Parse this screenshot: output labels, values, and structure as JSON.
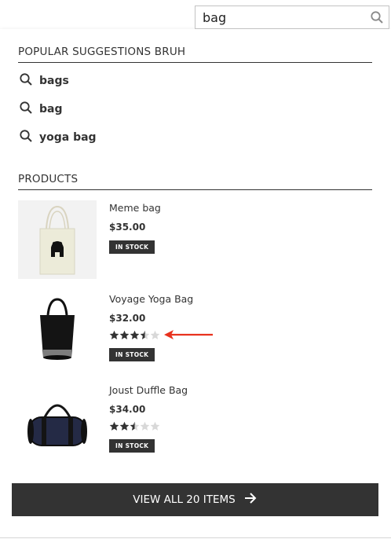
{
  "search": {
    "value": "bag"
  },
  "suggestions": {
    "title": "POPULAR SUGGESTIONS BRUH",
    "items": [
      {
        "label": "bags"
      },
      {
        "label": "bag"
      },
      {
        "label": "yoga bag"
      }
    ]
  },
  "products": {
    "title": "PRODUCTS",
    "items": [
      {
        "name": "Meme bag",
        "price": "$35.00",
        "rating": null,
        "stock": "IN STOCK"
      },
      {
        "name": "Voyage Yoga Bag",
        "price": "$32.00",
        "rating": 3.5,
        "stock": "IN STOCK"
      },
      {
        "name": "Joust Duffle Bag",
        "price": "$34.00",
        "rating": 2.5,
        "stock": "IN STOCK"
      }
    ]
  },
  "view_all": {
    "label": "VIEW ALL 20 ITEMS"
  },
  "colors": {
    "dark": "#333333",
    "annotation_arrow": "#e8321e",
    "star_filled": "#333333",
    "star_empty": "#d8d8d8"
  }
}
